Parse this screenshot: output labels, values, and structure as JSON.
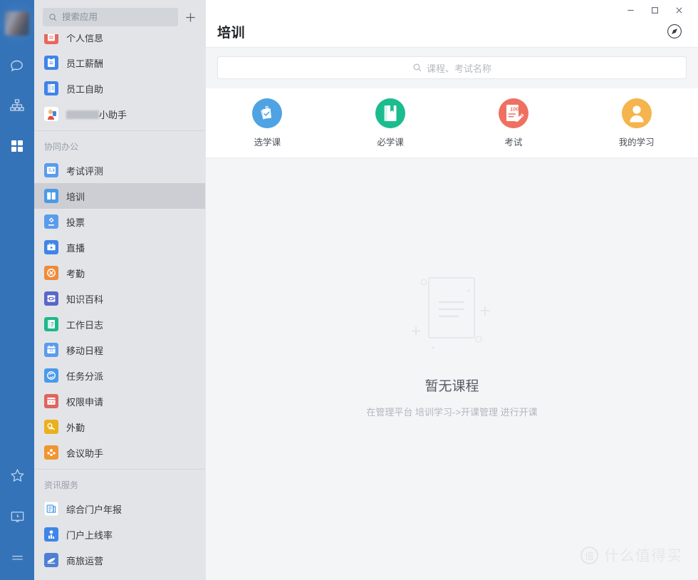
{
  "window": {
    "minimize_label": "—",
    "maximize_label": "□",
    "close_label": "✕"
  },
  "rail": {
    "items": [
      {
        "name": "avatar",
        "label": "头像"
      },
      {
        "name": "chat-icon",
        "label": "消息"
      },
      {
        "name": "org-chart-icon",
        "label": "组织"
      },
      {
        "name": "apps-grid-icon",
        "label": "应用"
      },
      {
        "name": "star-icon",
        "label": "收藏"
      },
      {
        "name": "screen-clock-icon",
        "label": "待办"
      },
      {
        "name": "menu-icon",
        "label": "菜单"
      }
    ]
  },
  "sidebar": {
    "search": {
      "placeholder": "搜索应用"
    },
    "add_label": "+",
    "groups": [
      {
        "title": "",
        "items": [
          {
            "label": "个人信息",
            "icon": "clipboard-red",
            "redacted": false,
            "active": false
          },
          {
            "label": "员工薪酬",
            "icon": "salary-blue",
            "redacted": false,
            "active": false
          },
          {
            "label": "员工自助",
            "icon": "selfservice-blue",
            "redacted": false,
            "active": false
          },
          {
            "label": "小助手",
            "icon": "mascot",
            "redacted": true,
            "active": false
          }
        ]
      },
      {
        "title": "协同办公",
        "items": [
          {
            "label": "考试评测",
            "icon": "exam-blue",
            "redacted": false,
            "active": false
          },
          {
            "label": "培训",
            "icon": "training-blue",
            "redacted": false,
            "active": true
          },
          {
            "label": "投票",
            "icon": "vote-blue",
            "redacted": false,
            "active": false
          },
          {
            "label": "直播",
            "icon": "live-blue",
            "redacted": false,
            "active": false
          },
          {
            "label": "考勤",
            "icon": "attendance-orange",
            "redacted": false,
            "active": false
          },
          {
            "label": "知识百科",
            "icon": "wiki-indigo",
            "redacted": false,
            "active": false
          },
          {
            "label": "工作日志",
            "icon": "worklog-green",
            "redacted": false,
            "active": false
          },
          {
            "label": "移动日程",
            "icon": "calendar-blue",
            "redacted": false,
            "active": false
          },
          {
            "label": "任务分派",
            "icon": "task-blue",
            "redacted": false,
            "active": false
          },
          {
            "label": "权限申请",
            "icon": "permission-red",
            "redacted": false,
            "active": false
          },
          {
            "label": "外勤",
            "icon": "fieldwork-yellow",
            "redacted": false,
            "active": false
          },
          {
            "label": "会议助手",
            "icon": "meeting-orange",
            "redacted": false,
            "active": false
          }
        ]
      },
      {
        "title": "资讯服务",
        "items": [
          {
            "label": "综合门户年报",
            "icon": "report-white",
            "redacted": false,
            "active": false
          },
          {
            "label": "门户上线率",
            "icon": "rate-blue",
            "redacted": false,
            "active": false
          },
          {
            "label": "商旅运营",
            "icon": "travel-blue",
            "redacted": false,
            "active": false
          }
        ]
      }
    ]
  },
  "main": {
    "title": "培训",
    "compass_icon": "compass-icon",
    "search": {
      "placeholder": "课程、考试名称",
      "value": ""
    },
    "categories": [
      {
        "label": "选学课",
        "icon": "elective-course-icon",
        "color": "#4fa3e3"
      },
      {
        "label": "必学课",
        "icon": "required-course-icon",
        "color": "#1bbc8e"
      },
      {
        "label": "考试",
        "icon": "exam-icon",
        "color": "#ef7060"
      },
      {
        "label": "我的学习",
        "icon": "my-study-icon",
        "color": "#f5b44d"
      }
    ],
    "empty": {
      "title": "暂无课程",
      "subtitle": "在管理平台 培训学习->开课管理 进行开课"
    }
  },
  "watermark": {
    "badge": "值",
    "text": "什么值得买"
  },
  "colors": {
    "rail_bg": "#3573b9",
    "sidebar_bg": "#e2e4e8",
    "sidebar_active": "#ccced3",
    "main_bg": "#f4f5f7",
    "panel_bg": "#ffffff",
    "text_primary": "#33363d",
    "text_muted": "#9aa0a8"
  }
}
